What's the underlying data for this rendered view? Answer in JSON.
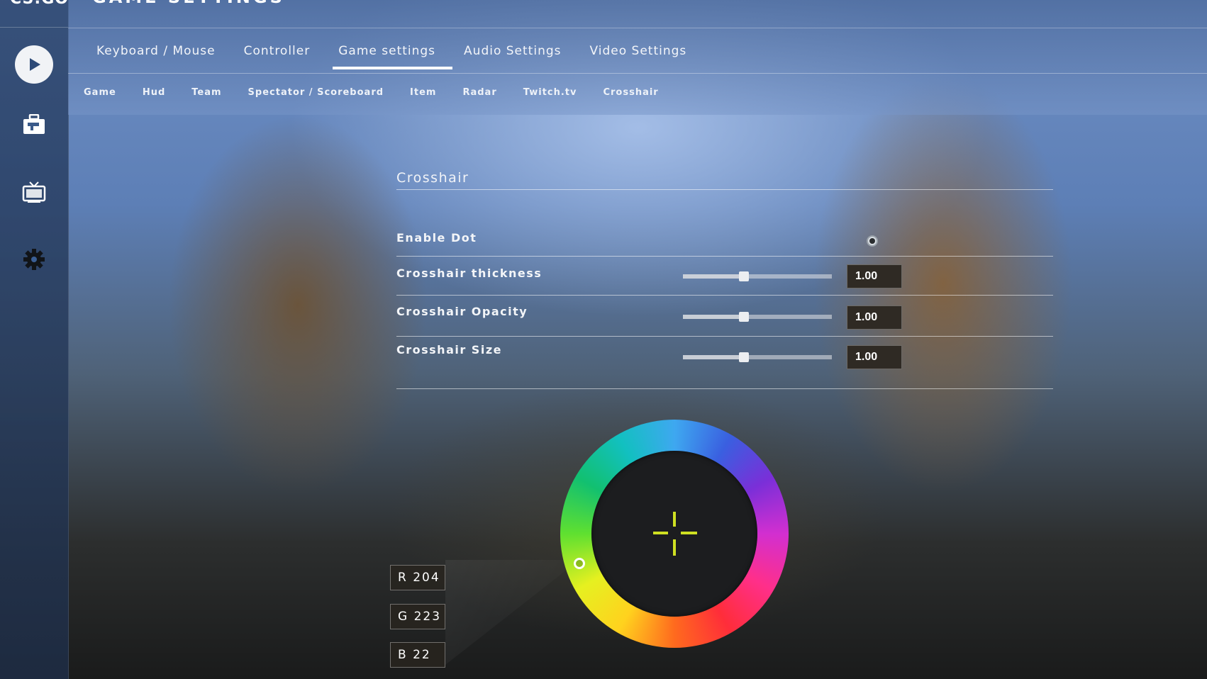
{
  "header": {
    "logo_text": "CS:GO",
    "title": "GAME SETTINGS"
  },
  "sidebar": {
    "items": [
      {
        "icon": "play-icon"
      },
      {
        "icon": "inventory-icon"
      },
      {
        "icon": "tv-icon"
      },
      {
        "icon": "gear-icon"
      }
    ]
  },
  "tabs": [
    {
      "label": "Keyboard / Mouse",
      "active": false
    },
    {
      "label": "Controller",
      "active": false
    },
    {
      "label": "Game settings",
      "active": true
    },
    {
      "label": "Audio Settings",
      "active": false
    },
    {
      "label": "Video Settings",
      "active": false
    }
  ],
  "subtabs": [
    {
      "label": "Game"
    },
    {
      "label": "Hud"
    },
    {
      "label": "Team"
    },
    {
      "label": "Spectator / Scoreboard"
    },
    {
      "label": "Item"
    },
    {
      "label": "Radar"
    },
    {
      "label": "Twitch.tv"
    },
    {
      "label": "Crosshair"
    }
  ],
  "crosshair": {
    "section_title": "Crosshair",
    "enable_dot": {
      "label": "Enable Dot",
      "checked": true
    },
    "settings": [
      {
        "label": "Crosshair thickness",
        "value": "1.00",
        "slider_fraction": 0.41
      },
      {
        "label": "Crosshair Opacity",
        "value": "1.00",
        "slider_fraction": 0.41
      },
      {
        "label": "Crosshair Size",
        "value": "1.00",
        "slider_fraction": 0.41
      }
    ],
    "color": {
      "r_label": "R 204",
      "g_label": "G 223",
      "b_label": "B 22",
      "hex": "#ccdf16"
    }
  },
  "colors": {
    "accent": "#ffffff",
    "crosshair": "#cfe022"
  }
}
